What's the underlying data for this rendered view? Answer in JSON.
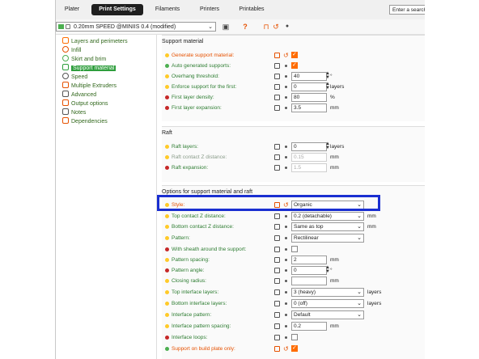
{
  "tabs": [
    "Plater",
    "Print Settings",
    "Filaments",
    "Printers",
    "Printables"
  ],
  "active_tab": "Print Settings",
  "search": {
    "value": "Enter a search"
  },
  "preset": {
    "label": "0.20mm SPEED @MINIIS 0.4 (modified)"
  },
  "sidebar": {
    "items": [
      {
        "label": "Layers and perimeters",
        "icon": "layers-icon",
        "color": "#ff6d00"
      },
      {
        "label": "Infill",
        "icon": "infill-icon",
        "color": "#e65100"
      },
      {
        "label": "Skirt and brim",
        "icon": "skirt-icon",
        "color": "#4caf50"
      },
      {
        "label": "Support material",
        "icon": "support-icon",
        "color": "#2e9e3c"
      },
      {
        "label": "Speed",
        "icon": "speed-icon",
        "color": "#555555"
      },
      {
        "label": "Multiple Extruders",
        "icon": "extruder-icon",
        "color": "#e65100"
      },
      {
        "label": "Advanced",
        "icon": "wrench-icon",
        "color": "#555555"
      },
      {
        "label": "Output options",
        "icon": "output-icon",
        "color": "#e65100"
      },
      {
        "label": "Notes",
        "icon": "notes-icon",
        "color": "#555555"
      },
      {
        "label": "Dependencies",
        "icon": "wrench-icon",
        "color": "#e65100"
      }
    ]
  },
  "sections": {
    "support": {
      "title": "Support material",
      "rows": [
        {
          "label": "Generate support material:",
          "value": "checked"
        },
        {
          "label": "Auto generated supports:",
          "value": "checked"
        },
        {
          "label": "Overhang threshold:",
          "value": "40",
          "unit": "°"
        },
        {
          "label": "Enforce support for the first:",
          "value": "0",
          "unit": "layers"
        },
        {
          "label": "First layer density:",
          "value": "80",
          "unit": "%"
        },
        {
          "label": "First layer expansion:",
          "value": "3.5",
          "unit": "mm"
        }
      ]
    },
    "raft": {
      "title": "Raft",
      "rows": [
        {
          "label": "Raft layers:",
          "value": "0",
          "unit": "layers"
        },
        {
          "label": "Raft contact Z distance:",
          "value": "0.15",
          "unit": "mm"
        },
        {
          "label": "Raft expansion:",
          "value": "1.5",
          "unit": "mm"
        }
      ]
    },
    "options": {
      "title": "Options for support material and raft",
      "rows": [
        {
          "label": "Style:",
          "value": "Organic"
        },
        {
          "label": "Top contact Z distance:",
          "value": "0.2 (detachable)",
          "unit": "mm"
        },
        {
          "label": "Bottom contact Z distance:",
          "value": "Same as top",
          "unit": "mm"
        },
        {
          "label": "Pattern:",
          "value": "Rectilinear"
        },
        {
          "label": "With sheath around the support:",
          "value": "unchecked"
        },
        {
          "label": "Pattern spacing:",
          "value": "2",
          "unit": "mm"
        },
        {
          "label": "Pattern angle:",
          "value": "0",
          "unit": "°"
        },
        {
          "label": "Closing radius:",
          "value": "",
          "unit": "mm"
        },
        {
          "label": "Top interface layers:",
          "value": "3 (heavy)",
          "unit": "layers"
        },
        {
          "label": "Bottom interface layers:",
          "value": "0 (off)",
          "unit": "layers"
        },
        {
          "label": "Interface pattern:",
          "value": "Default"
        },
        {
          "label": "Interface pattern spacing:",
          "value": "0.2",
          "unit": "mm"
        },
        {
          "label": "Interface loops:",
          "value": "unchecked"
        },
        {
          "label": "Support on build plate only:",
          "value": "checked"
        }
      ]
    }
  },
  "colors": {
    "accent": "#ff6d00",
    "label_green": "#2e7d32",
    "highlight": "#1a2fd1"
  }
}
